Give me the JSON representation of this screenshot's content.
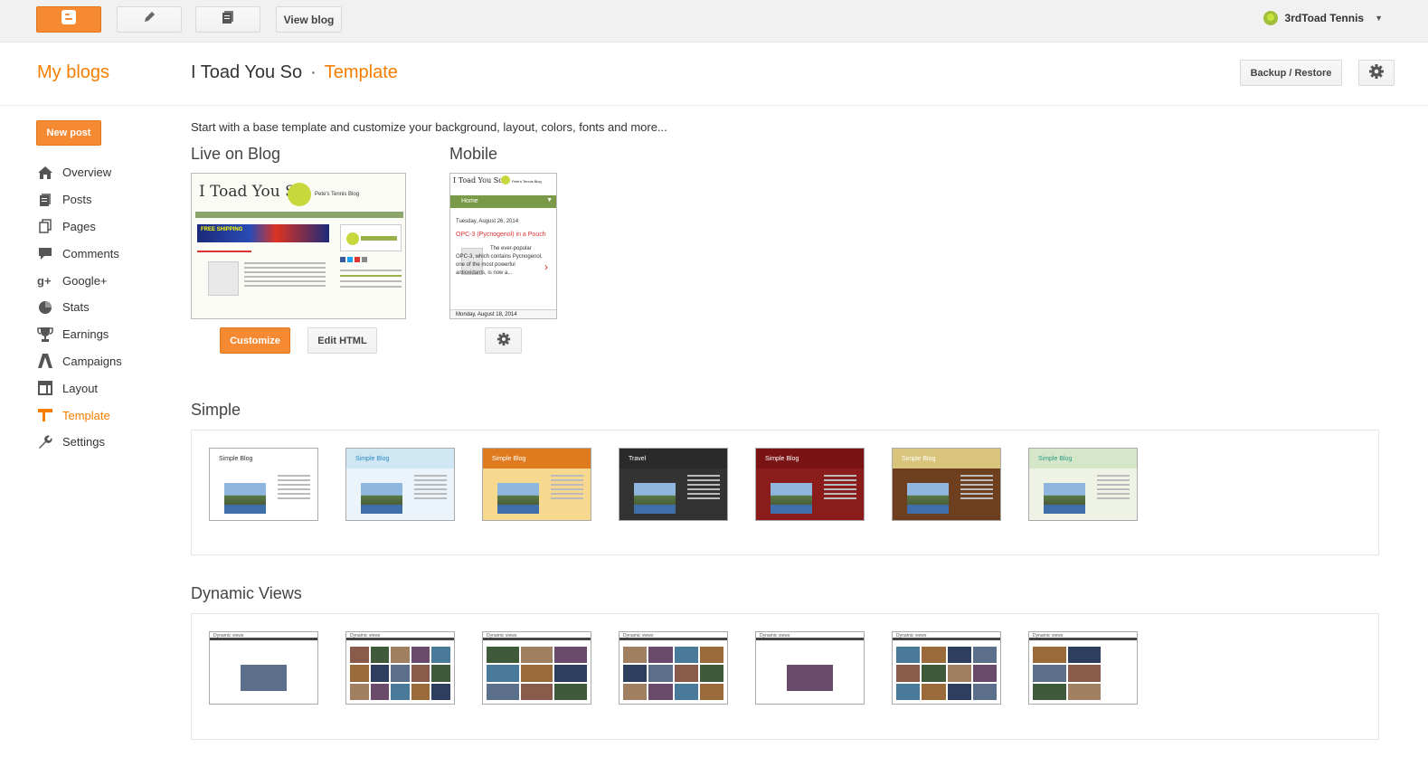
{
  "topbar": {
    "view_blog": "View blog",
    "user_name": "3rdToad Tennis"
  },
  "header": {
    "my_blogs": "My blogs",
    "blog_name": "I Toad You So",
    "separator": "·",
    "current_page": "Template",
    "backup_restore": "Backup / Restore"
  },
  "sidebar": {
    "new_post": "New post",
    "items": [
      {
        "label": "Overview",
        "icon": "home-icon"
      },
      {
        "label": "Posts",
        "icon": "posts-icon"
      },
      {
        "label": "Pages",
        "icon": "pages-icon"
      },
      {
        "label": "Comments",
        "icon": "comments-icon"
      },
      {
        "label": "Google+",
        "icon": "google-plus-icon"
      },
      {
        "label": "Stats",
        "icon": "stats-icon"
      },
      {
        "label": "Earnings",
        "icon": "trophy-icon"
      },
      {
        "label": "Campaigns",
        "icon": "campaigns-icon"
      },
      {
        "label": "Layout",
        "icon": "layout-icon"
      },
      {
        "label": "Template",
        "icon": "template-icon",
        "active": true
      },
      {
        "label": "Settings",
        "icon": "wrench-icon"
      }
    ]
  },
  "main": {
    "intro": "Start with a base template and customize your background, layout, colors, fonts and more...",
    "live_title": "Live on Blog",
    "mobile_title": "Mobile",
    "customize": "Customize",
    "edit_html": "Edit HTML",
    "live_preview": {
      "blog_title": "I Toad You So",
      "blog_subtitle": "Pete's Tennis Blog",
      "ad_text": "FREE SHIPPING"
    },
    "mobile_preview": {
      "blog_title": "I Toad You So",
      "blog_subtitle": "Pete's Tennis Blog",
      "home": "Home",
      "date1": "Tuesday, August 26, 2014",
      "post_title": "OPC-3 (Pycnogenol) in a Pouch",
      "post_text": "The ever-popular OPC-3, which contains Pycnogenol, one of the most powerful antioxidants, is now a...",
      "date2": "Monday, August 18, 2014"
    },
    "simple_title": "Simple",
    "simple_thumbs": [
      {
        "label": "Simple Blog",
        "bg": "#ffffff",
        "hdr": "#ffffff",
        "text": "#333333"
      },
      {
        "label": "Simple Blog",
        "bg": "#eaf4fa",
        "hdr": "#cfe6f3",
        "text": "#2a8ac6"
      },
      {
        "label": "Simple Blog",
        "bg": "#f6d98f",
        "hdr": "#e07a1f",
        "text": "#ffffff"
      },
      {
        "label": "Travel",
        "bg": "#333333",
        "hdr": "#2a2a2a",
        "text": "#ffffff"
      },
      {
        "label": "Simple Blog",
        "bg": "#8b1c1c",
        "hdr": "#7a1414",
        "text": "#ffffff"
      },
      {
        "label": "Simple Blog",
        "bg": "#6e3f1e",
        "hdr": "#d8c47a",
        "text": "#ffffff"
      },
      {
        "label": "Simple Blog",
        "bg": "#eef3e6",
        "hdr": "#d6e6c8",
        "text": "#2a9a8a"
      }
    ],
    "dynamic_title": "Dynamic Views",
    "dynamic_thumbs": [
      {
        "label": "Dynamic views",
        "cols": 1
      },
      {
        "label": "Dynamic views",
        "cols": 5
      },
      {
        "label": "Dynamic views",
        "cols": 3
      },
      {
        "label": "Dynamic views",
        "cols": 4
      },
      {
        "label": "Dynamic views",
        "cols": 1
      },
      {
        "label": "Dynamic views",
        "cols": 4
      },
      {
        "label": "Dynamic views",
        "cols": 2
      }
    ]
  },
  "colors": {
    "accent": "#f57d00",
    "button_orange": "#f58a33"
  }
}
